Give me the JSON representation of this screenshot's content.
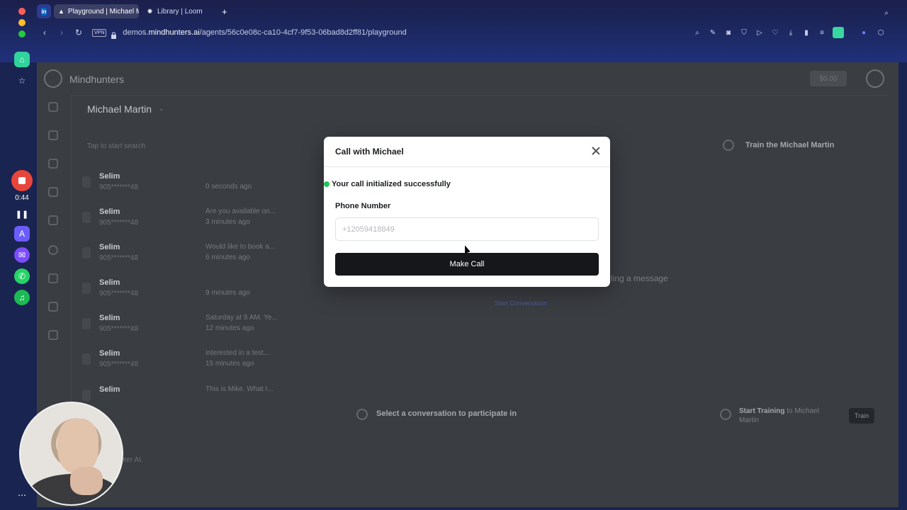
{
  "browser": {
    "tabs": [
      {
        "label": "",
        "icon": "linkedin-icon"
      },
      {
        "label": "Playground | Michael Ma",
        "icon": "mindhunters-favicon",
        "active": true
      },
      {
        "label": "Library | Loom",
        "icon": "loom-icon"
      }
    ],
    "url_prefix": "demos.",
    "url_domain": "mindhunters.ai",
    "url_path": "/agents/56c0e08c-ca10-4cf7-9f53-06bad8d2ff81/playground",
    "vpn_label": "VPN"
  },
  "recorder": {
    "timer": "0:44"
  },
  "app": {
    "brand": "Mindhunters",
    "wallet": "$0.00",
    "agent_name": "Michael Martin",
    "search_placeholder": "Tap to start search",
    "train_title": "Train the Michael Martin",
    "message_hint": "ling a message",
    "start_conversation": "Start Conversation",
    "select_conversation": "Select a conversation to participate in",
    "start_training_bold": "Start Training",
    "start_training_rest": " to Michael Martin",
    "train_button": "Train",
    "footer": "nter AI.",
    "conversations": [
      {
        "name": "Selim",
        "phone": "905*******48",
        "preview": "",
        "time": "0 seconds ago"
      },
      {
        "name": "Selim",
        "phone": "905*******48",
        "preview": "Are you available on...",
        "time": "3 minutes ago"
      },
      {
        "name": "Selim",
        "phone": "905*******48",
        "preview": "Would like to book a...",
        "time": "6 minutes ago"
      },
      {
        "name": "Selim",
        "phone": "905*******48",
        "preview": "",
        "time": "9 minutes ago"
      },
      {
        "name": "Selim",
        "phone": "905*******48",
        "preview": "Saturday at 8 AM. Ye...",
        "time": "12 minutes ago"
      },
      {
        "name": "Selim",
        "phone": "905*******48",
        "preview": "interested in a test...",
        "time": "15 minutes ago"
      },
      {
        "name": "Selim",
        "phone": "",
        "preview": "This is Mike. What I...",
        "time": ""
      }
    ]
  },
  "modal": {
    "title": "Call with Michael",
    "status": "Your call initialized successfully",
    "phone_label": "Phone Number",
    "phone_placeholder": "+12059418849",
    "phone_value": "",
    "button": "Make Call",
    "status_color": "#22c55e"
  }
}
